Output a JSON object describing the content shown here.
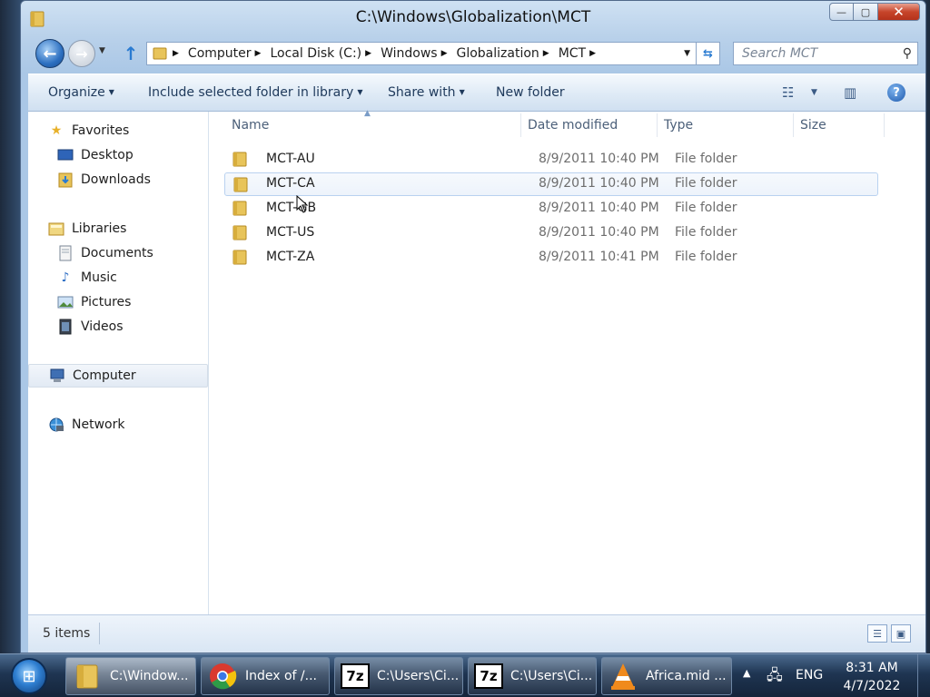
{
  "window": {
    "title": "C:\\Windows\\Globalization\\MCT",
    "controls": {
      "minimize": "—",
      "maximize": "▢",
      "close": "✕"
    }
  },
  "address_bar": {
    "crumbs": [
      "Computer",
      "Local Disk (C:)",
      "Windows",
      "Globalization",
      "MCT"
    ]
  },
  "search": {
    "placeholder": "Search MCT"
  },
  "toolbar": {
    "organize": "Organize",
    "include_library": "Include selected folder in library",
    "share_with": "Share with",
    "new_folder": "New folder"
  },
  "nav_pane": {
    "favorites": {
      "label": "Favorites",
      "items": [
        "Desktop",
        "Downloads"
      ]
    },
    "libraries": {
      "label": "Libraries",
      "items": [
        "Documents",
        "Music",
        "Pictures",
        "Videos"
      ]
    },
    "computer": "Computer",
    "network": "Network"
  },
  "columns": {
    "name": "Name",
    "date_modified": "Date modified",
    "type": "Type",
    "size": "Size"
  },
  "files": [
    {
      "name": "MCT-AU",
      "date": "8/9/2011 10:40 PM",
      "type": "File folder"
    },
    {
      "name": "MCT-CA",
      "date": "8/9/2011 10:40 PM",
      "type": "File folder"
    },
    {
      "name": "MCT-GB",
      "date": "8/9/2011 10:40 PM",
      "type": "File folder"
    },
    {
      "name": "MCT-US",
      "date": "8/9/2011 10:40 PM",
      "type": "File folder"
    },
    {
      "name": "MCT-ZA",
      "date": "8/9/2011 10:41 PM",
      "type": "File folder"
    }
  ],
  "status": {
    "items": "5 items"
  },
  "taskbar": {
    "tasks": [
      {
        "label": "C:\\Window...",
        "icon": "folder-icon"
      },
      {
        "label": "Index of /...",
        "icon": "chrome-icon"
      },
      {
        "label": "C:\\Users\\Ci...",
        "icon": "7zip-icon"
      },
      {
        "label": "C:\\Users\\Ci...",
        "icon": "7zip-icon"
      },
      {
        "label": "Africa.mid ...",
        "icon": "vlc-icon"
      }
    ],
    "seven_zip_glyph": "7z",
    "language": "ENG",
    "time": "8:31 AM",
    "date": "4/7/2022"
  },
  "colors": {
    "accent": "#2a7bd1",
    "folder": "#e8c45a",
    "hover_row": "#b9d2f0"
  }
}
